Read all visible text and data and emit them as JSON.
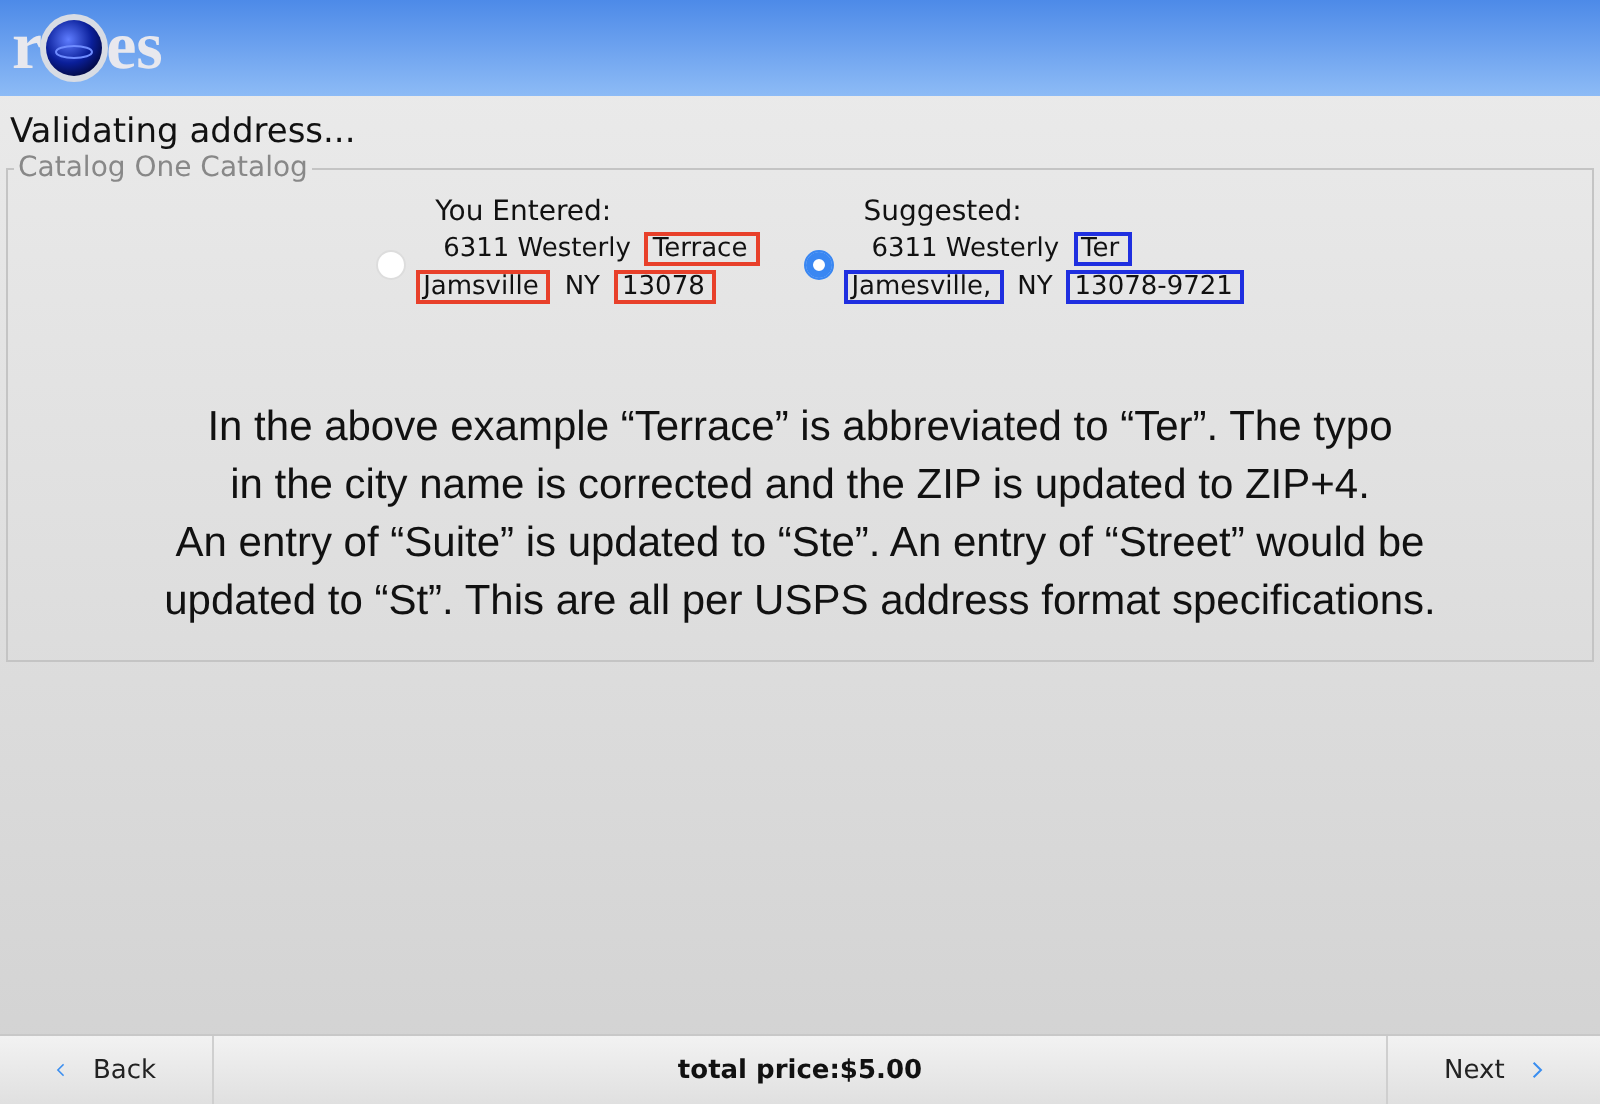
{
  "logo": {
    "before": "r",
    "after": "es"
  },
  "status": "Validating address...",
  "group": {
    "title": "Catalog One Catalog",
    "options": [
      {
        "heading": "You Entered:",
        "selected": false,
        "color": "#e8402a",
        "lines": [
          [
            {
              "text": "6311 Westerly",
              "highlighted": false
            },
            {
              "text": "Terrace",
              "highlighted": true
            }
          ],
          [
            {
              "text": "Jamsville",
              "highlighted": true
            },
            {
              "text": "NY",
              "highlighted": false
            },
            {
              "text": "13078",
              "highlighted": true
            }
          ]
        ]
      },
      {
        "heading": "Suggested:",
        "selected": true,
        "color": "#1f2fe0",
        "lines": [
          [
            {
              "text": "6311 Westerly",
              "highlighted": false
            },
            {
              "text": "Ter",
              "highlighted": true
            }
          ],
          [
            {
              "text": "Jamesville,",
              "highlighted": true
            },
            {
              "text": "NY",
              "highlighted": false
            },
            {
              "text": "13078-9721",
              "highlighted": true
            }
          ]
        ]
      }
    ],
    "note_lines": [
      "In the above example “Terrace” is abbreviated to “Ter”. The typo",
      "in the city name is corrected and the ZIP is updated to ZIP+4.",
      "An entry of “Suite” is updated to “Ste”. An entry of “Street” would be",
      "updated to “St”. This are all per USPS address format specifications."
    ]
  },
  "footer": {
    "back": "Back",
    "total": "total price:$5.00",
    "next": "Next"
  }
}
